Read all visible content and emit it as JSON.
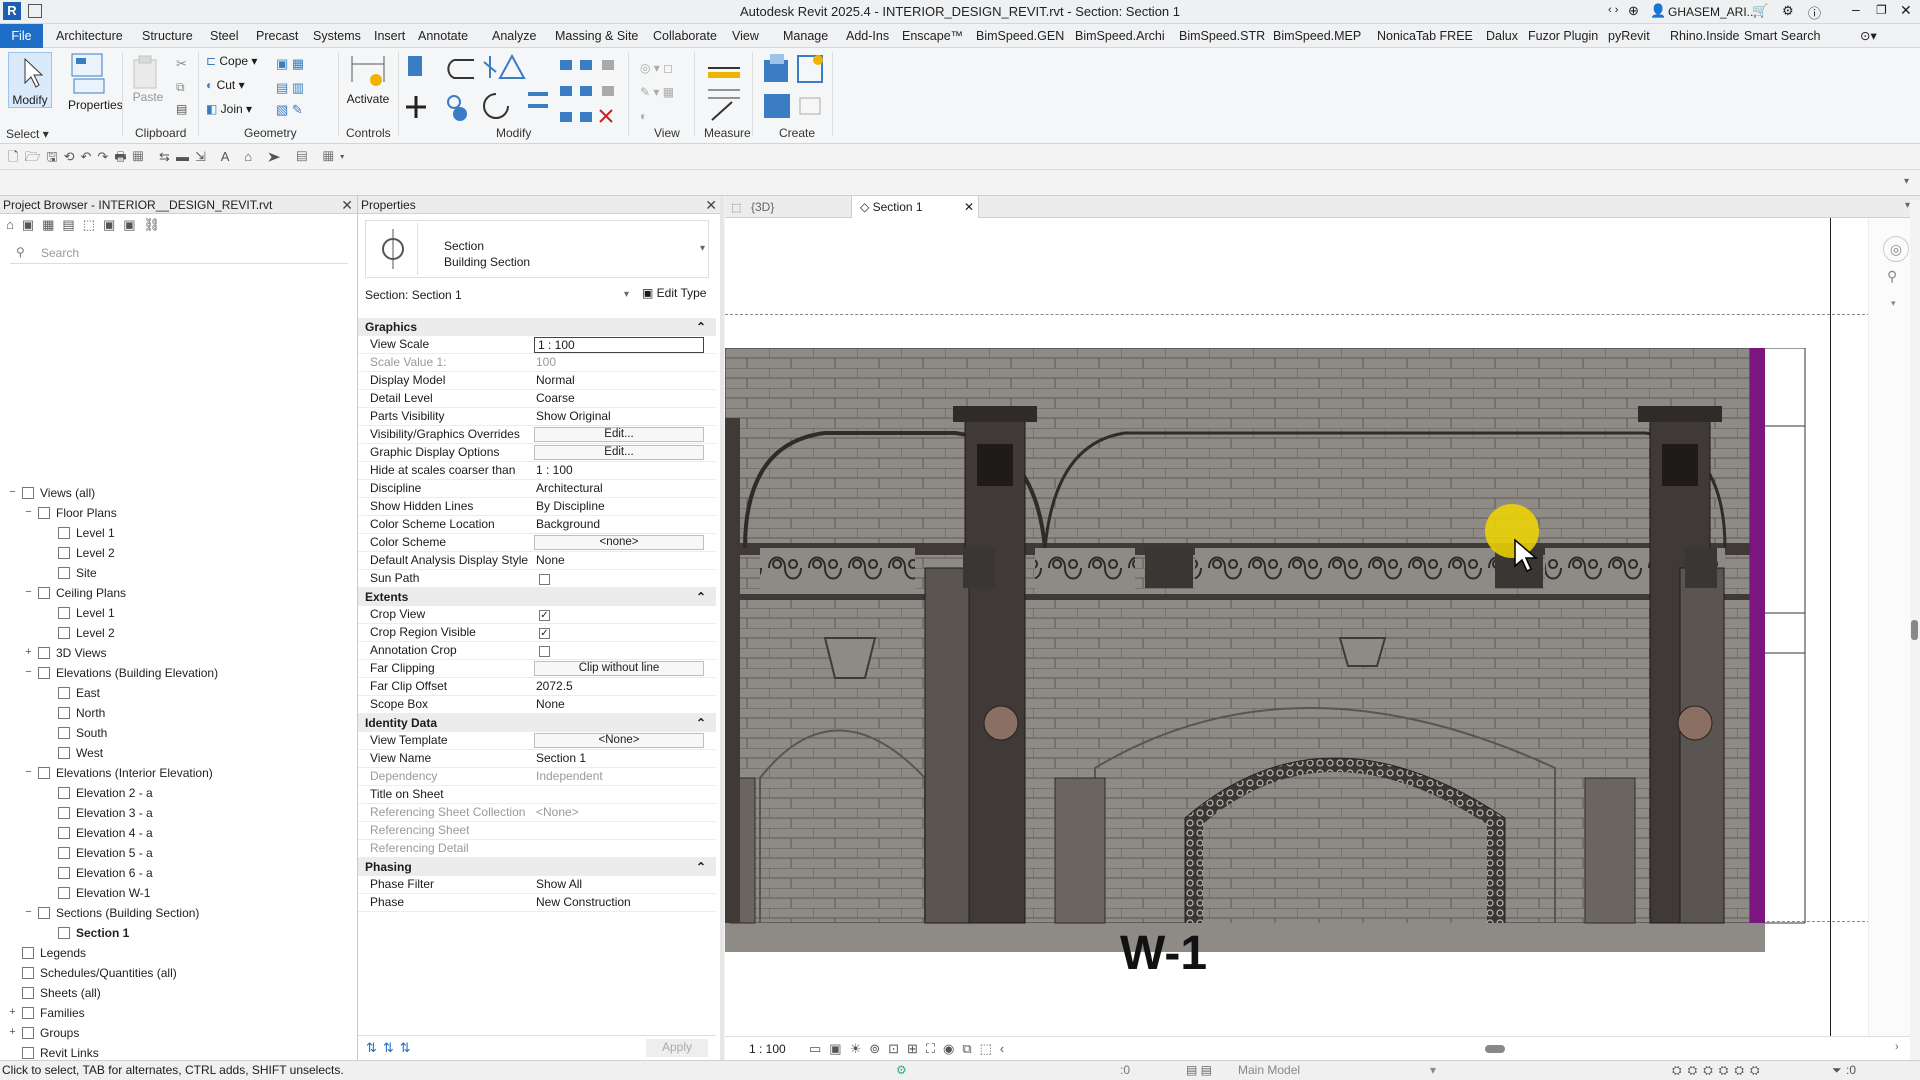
{
  "titlebar": {
    "title": "Autodesk Revit 2025.4 - INTERIOR_DESIGN_REVIT.rvt - Section: Section 1",
    "user": "GHASEM_ARI...",
    "logo": "R"
  },
  "menu": [
    "File",
    "Architecture",
    "Structure",
    "Steel",
    "Precast",
    "Systems",
    "Insert",
    "Annotate",
    "Analyze",
    "Massing & Site",
    "Collaborate",
    "View",
    "Manage",
    "Add-Ins",
    "Enscape™",
    "BimSpeed.GEN",
    "BimSpeed.Archi",
    "BimSpeed.STR",
    "BimSpeed.MEP",
    "NonicaTab FREE",
    "Dalux",
    "Fuzor Plugin",
    "pyRevit",
    "Rhino.Inside",
    "Smart Search"
  ],
  "ribbon": {
    "modify": "Modify",
    "properties": "Properties",
    "paste": "Paste",
    "cope": "Cope",
    "cut": "Cut",
    "join": "Join",
    "activate": "Activate",
    "panels": {
      "select": "Select",
      "properties": "Properties",
      "clipboard": "Clipboard",
      "geometry": "Geometry",
      "controls": "Controls",
      "modify": "Modify",
      "view": "View",
      "measure": "Measure",
      "create": "Create"
    }
  },
  "project_browser": {
    "title": "Project Browser - INTERIOR__DESIGN_REVIT.rvt",
    "search_placeholder": "Search",
    "items": [
      {
        "label": "Views (all)",
        "level": 0,
        "exp": "−"
      },
      {
        "label": "Floor Plans",
        "level": 1,
        "exp": "−"
      },
      {
        "label": "Level 1",
        "level": 2
      },
      {
        "label": "Level 2",
        "level": 2
      },
      {
        "label": "Site",
        "level": 2
      },
      {
        "label": "Ceiling Plans",
        "level": 1,
        "exp": "−"
      },
      {
        "label": "Level 1",
        "level": 2
      },
      {
        "label": "Level 2",
        "level": 2
      },
      {
        "label": "3D Views",
        "level": 1,
        "exp": "+"
      },
      {
        "label": "Elevations (Building Elevation)",
        "level": 1,
        "exp": "−"
      },
      {
        "label": "East",
        "level": 2
      },
      {
        "label": "North",
        "level": 2
      },
      {
        "label": "South",
        "level": 2
      },
      {
        "label": "West",
        "level": 2
      },
      {
        "label": "Elevations (Interior Elevation)",
        "level": 1,
        "exp": "−"
      },
      {
        "label": "Elevation 2 - a",
        "level": 2
      },
      {
        "label": "Elevation 3 - a",
        "level": 2
      },
      {
        "label": "Elevation 4 - a",
        "level": 2
      },
      {
        "label": "Elevation 5 - a",
        "level": 2
      },
      {
        "label": "Elevation 6 - a",
        "level": 2
      },
      {
        "label": "Elevation W-1",
        "level": 2
      },
      {
        "label": "Sections (Building Section)",
        "level": 1,
        "exp": "−"
      },
      {
        "label": "Section 1",
        "level": 2,
        "bold": true
      },
      {
        "label": "Legends",
        "level": 0
      },
      {
        "label": "Schedules/Quantities (all)",
        "level": 0
      },
      {
        "label": "Sheets (all)",
        "level": 0
      },
      {
        "label": "Families",
        "level": 0,
        "exp": "+"
      },
      {
        "label": "Groups",
        "level": 0,
        "exp": "+"
      },
      {
        "label": "Revit Links",
        "level": 0
      }
    ]
  },
  "properties": {
    "title": "Properties",
    "type_line1": "Section",
    "type_line2": "Building Section",
    "instance": "Section: Section 1",
    "edit_type": "Edit Type",
    "apply": "Apply",
    "rows": [
      {
        "t": "h",
        "label": "Graphics"
      },
      {
        "label": "View Scale",
        "value": "1 : 100",
        "input": true
      },
      {
        "label": "Scale Value    1:",
        "value": "100",
        "gray": true
      },
      {
        "label": "Display Model",
        "value": "Normal"
      },
      {
        "label": "Detail Level",
        "value": "Coarse"
      },
      {
        "label": "Parts Visibility",
        "value": "Show Original"
      },
      {
        "label": "Visibility/Graphics Overrides",
        "value": "Edit...",
        "btn": true
      },
      {
        "label": "Graphic Display Options",
        "value": "Edit...",
        "btn": true
      },
      {
        "label": "Hide at scales coarser than",
        "value": "1 : 100"
      },
      {
        "label": "Discipline",
        "value": "Architectural"
      },
      {
        "label": "Show Hidden Lines",
        "value": "By Discipline"
      },
      {
        "label": "Color Scheme Location",
        "value": "Background"
      },
      {
        "label": "Color Scheme",
        "value": "<none>",
        "btn": true
      },
      {
        "label": "Default Analysis Display Style",
        "value": "None"
      },
      {
        "label": "Sun Path",
        "chk": false
      },
      {
        "t": "h",
        "label": "Extents"
      },
      {
        "label": "Crop View",
        "chk": true
      },
      {
        "label": "Crop Region Visible",
        "chk": true
      },
      {
        "label": "Annotation Crop",
        "chk": false
      },
      {
        "label": "Far Clipping",
        "value": "Clip without line",
        "btn": true
      },
      {
        "label": "Far Clip Offset",
        "value": "2072.5"
      },
      {
        "label": "Scope Box",
        "value": "None"
      },
      {
        "t": "h",
        "label": "Identity Data"
      },
      {
        "label": "View Template",
        "value": "<None>",
        "btn": true
      },
      {
        "label": "View Name",
        "value": "Section 1"
      },
      {
        "label": "Dependency",
        "value": "Independent",
        "gray": true
      },
      {
        "label": "Title on Sheet",
        "value": ""
      },
      {
        "label": "Referencing Sheet Collection",
        "value": "<None>",
        "gray": true
      },
      {
        "label": "Referencing Sheet",
        "value": "",
        "gray": true
      },
      {
        "label": "Referencing Detail",
        "value": "",
        "gray": true
      },
      {
        "t": "h",
        "label": "Phasing"
      },
      {
        "label": "Phase Filter",
        "value": "Show All"
      },
      {
        "label": "Phase",
        "value": "New Construction"
      }
    ]
  },
  "view": {
    "tabs": [
      {
        "label": "{3D}"
      },
      {
        "label": "Section 1",
        "active": true
      }
    ],
    "drawing_label": "W-1",
    "scale": "1 : 100"
  },
  "statusbar": {
    "hint": "Click to select, TAB for alternates, CTRL adds, SHIFT unselects.",
    "zero": ":0",
    "model": "Main Model",
    "filter": ":0"
  },
  "colors": {
    "accent": "#1e6ec8",
    "wall": "#8e8a85",
    "dark": "#3f3a37",
    "purple": "#7b1680",
    "cursor_highlight": "#f2d600"
  }
}
